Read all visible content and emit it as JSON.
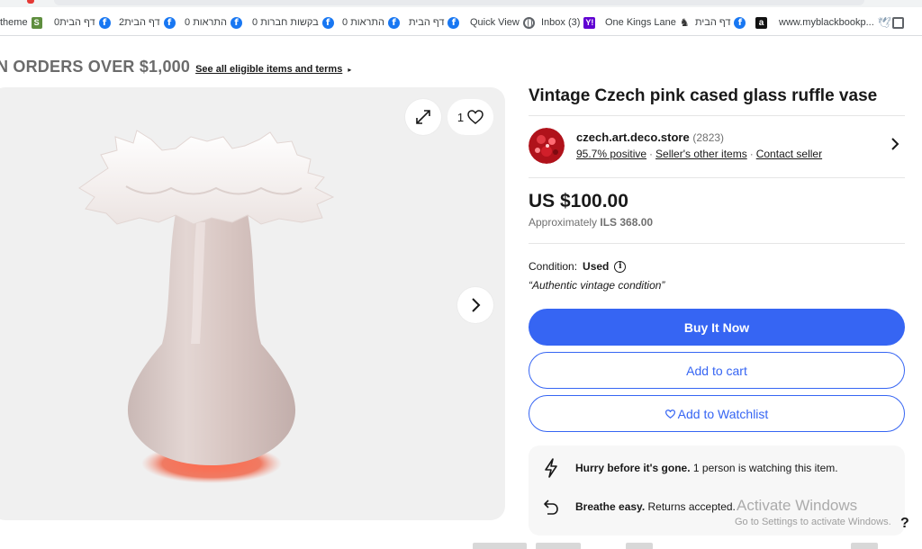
{
  "bookmarks": [
    {
      "label": "theme",
      "icon": "shopify-icon"
    },
    {
      "label": "0דף הבית",
      "icon": "facebook-icon"
    },
    {
      "label": "2דף הבית",
      "icon": "facebook-icon"
    },
    {
      "label": "0 התראות",
      "icon": "facebook-icon"
    },
    {
      "label": "0 בקשות חברות",
      "icon": "facebook-icon"
    },
    {
      "label": "0 התראות",
      "icon": "facebook-icon"
    },
    {
      "label": "דף הבית",
      "icon": "facebook-icon"
    },
    {
      "label": "Quick View",
      "icon": "globe-icon"
    },
    {
      "label": "Inbox (3)",
      "icon": "yahoo-icon"
    },
    {
      "label": "One Kings Lane",
      "icon": "one-kings-lane-icon"
    },
    {
      "label": "דף הבית",
      "icon": "facebook-icon"
    },
    {
      "label": "",
      "icon": "amazon-icon"
    },
    {
      "label": "www.myblackbookp...",
      "icon": "bird-icon"
    },
    {
      "label": "",
      "icon": "bookmark-square-icon"
    }
  ],
  "promo": {
    "text": "N ORDERS OVER $1,000",
    "link": "See all eligible items and terms",
    "arrow": "▸"
  },
  "gallery": {
    "watch_count": "1"
  },
  "product": {
    "title": "Vintage Czech pink cased glass ruffle vase",
    "price": "US $100.00",
    "approx_label": "Approximately",
    "approx_value": "ILS 368.00",
    "condition_label": "Condition:",
    "condition_value": "Used",
    "condition_note": "“Authentic vintage condition”"
  },
  "seller": {
    "name": "czech.art.deco.store",
    "feedback_count": "(2823)",
    "positive": "95.7% positive",
    "other_items": "Seller's other items",
    "contact": "Contact seller"
  },
  "buttons": {
    "buy": "Buy It Now",
    "cart": "Add to cart",
    "watch": "Add to Watchlist"
  },
  "info": {
    "hurry_bold": "Hurry before it's gone.",
    "hurry_rest": " 1 person is watching this item.",
    "returns_bold": "Breathe easy.",
    "returns_rest": " Returns accepted."
  },
  "watermark": {
    "title": "Activate Windows",
    "subtitle": "Go to Settings to activate Windows."
  },
  "help": "?",
  "colors": {
    "primary": "#3665f3",
    "text": "#191919",
    "muted": "#707070",
    "gallery_bg": "#f0f0f0",
    "facebook": "#1877f2"
  }
}
